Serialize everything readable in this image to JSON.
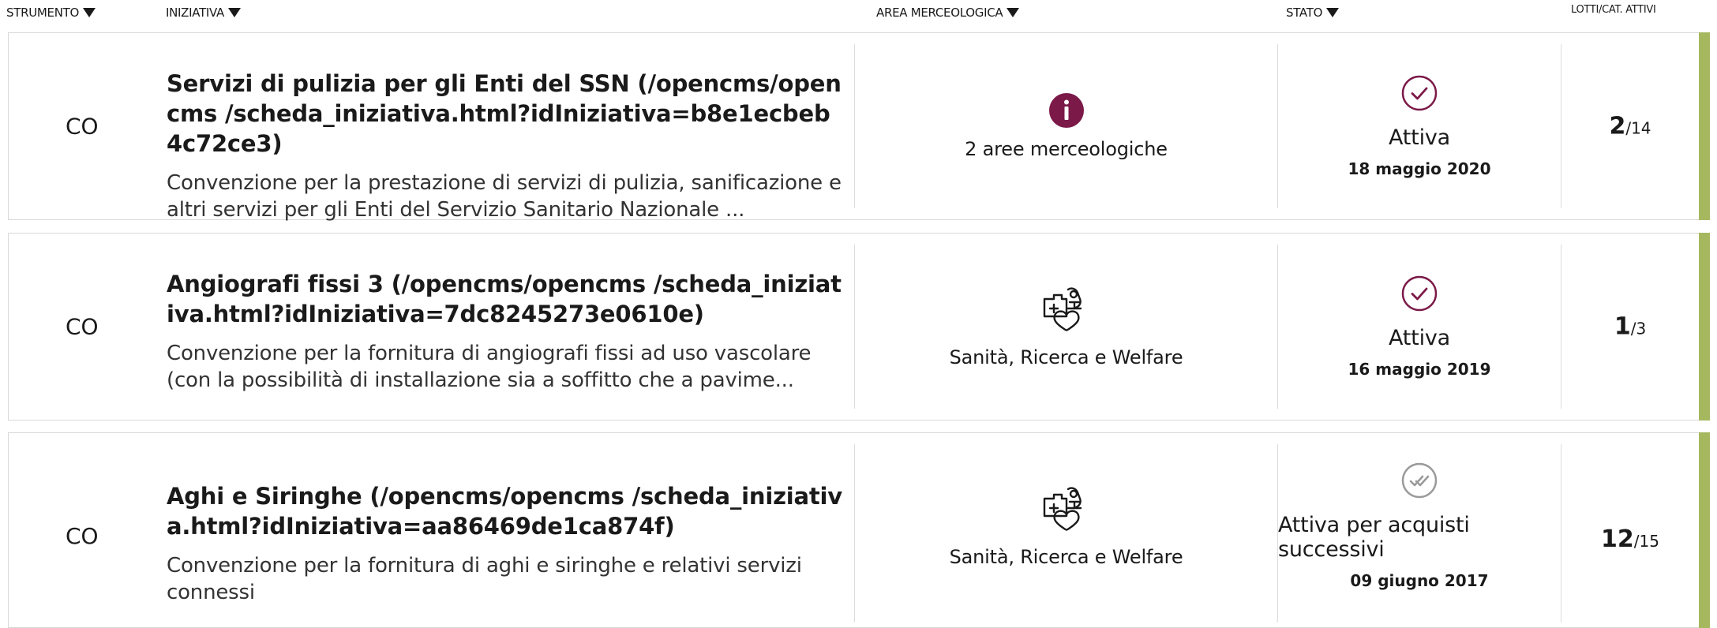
{
  "header": {
    "strumento": "STRUMENTO",
    "iniziativa": "INIZIATIVA",
    "area": "AREA MERCEOLOGICA",
    "stato": "STATO",
    "lotti": "LOTTI/CAT. ATTIVI"
  },
  "colors": {
    "accent_purple": "#7b1948",
    "status_green_bar": "#a5b85f",
    "inactive_grey": "#9a9a9a"
  },
  "rows": [
    {
      "strumento": "CO",
      "title": "Servizi di pulizia per gli Enti del SSN (/opencms/opencms /scheda_iniziativa.html?idIniziativa=b8e1ecbeb4c72ce3)",
      "description": "Convenzione per la prestazione di servizi di pulizia, sanificazione e altri servizi per gli Enti del Servizio Sanitario Nazionale ...",
      "area_icon": "info-icon",
      "area_label": "2 aree merceologiche",
      "status_icon": "check-circle-icon",
      "status": "Attiva",
      "status_date": "18 maggio 2020",
      "lotti_active": "2",
      "lotti_total": "/14"
    },
    {
      "strumento": "CO",
      "title": "Angiografi fissi 3 (/opencms/opencms /scheda_iniziativa.html?idIniziativa=7dc8245273e0610e)",
      "description": "Convenzione per la fornitura di angiografi fissi ad uso vascolare (con la possibilità di installazione sia a soffitto che a pavime...",
      "area_icon": "health-research-icon",
      "area_label": "Sanità, Ricerca e Welfare",
      "status_icon": "check-circle-icon",
      "status": "Attiva",
      "status_date": "16 maggio 2019",
      "lotti_active": "1",
      "lotti_total": "/3"
    },
    {
      "strumento": "CO",
      "title": "Aghi e Siringhe (/opencms/opencms /scheda_iniziativa.html?idIniziativa=aa86469de1ca874f)",
      "description": "Convenzione per la fornitura di aghi e siringhe e relativi servizi connessi",
      "area_icon": "health-research-icon",
      "area_label": "Sanità, Ricerca e Welfare",
      "status_icon": "double-check-circle-icon",
      "status": "Attiva per acquisti successivi",
      "status_date": "09 giugno 2017",
      "lotti_active": "12",
      "lotti_total": "/15"
    }
  ]
}
